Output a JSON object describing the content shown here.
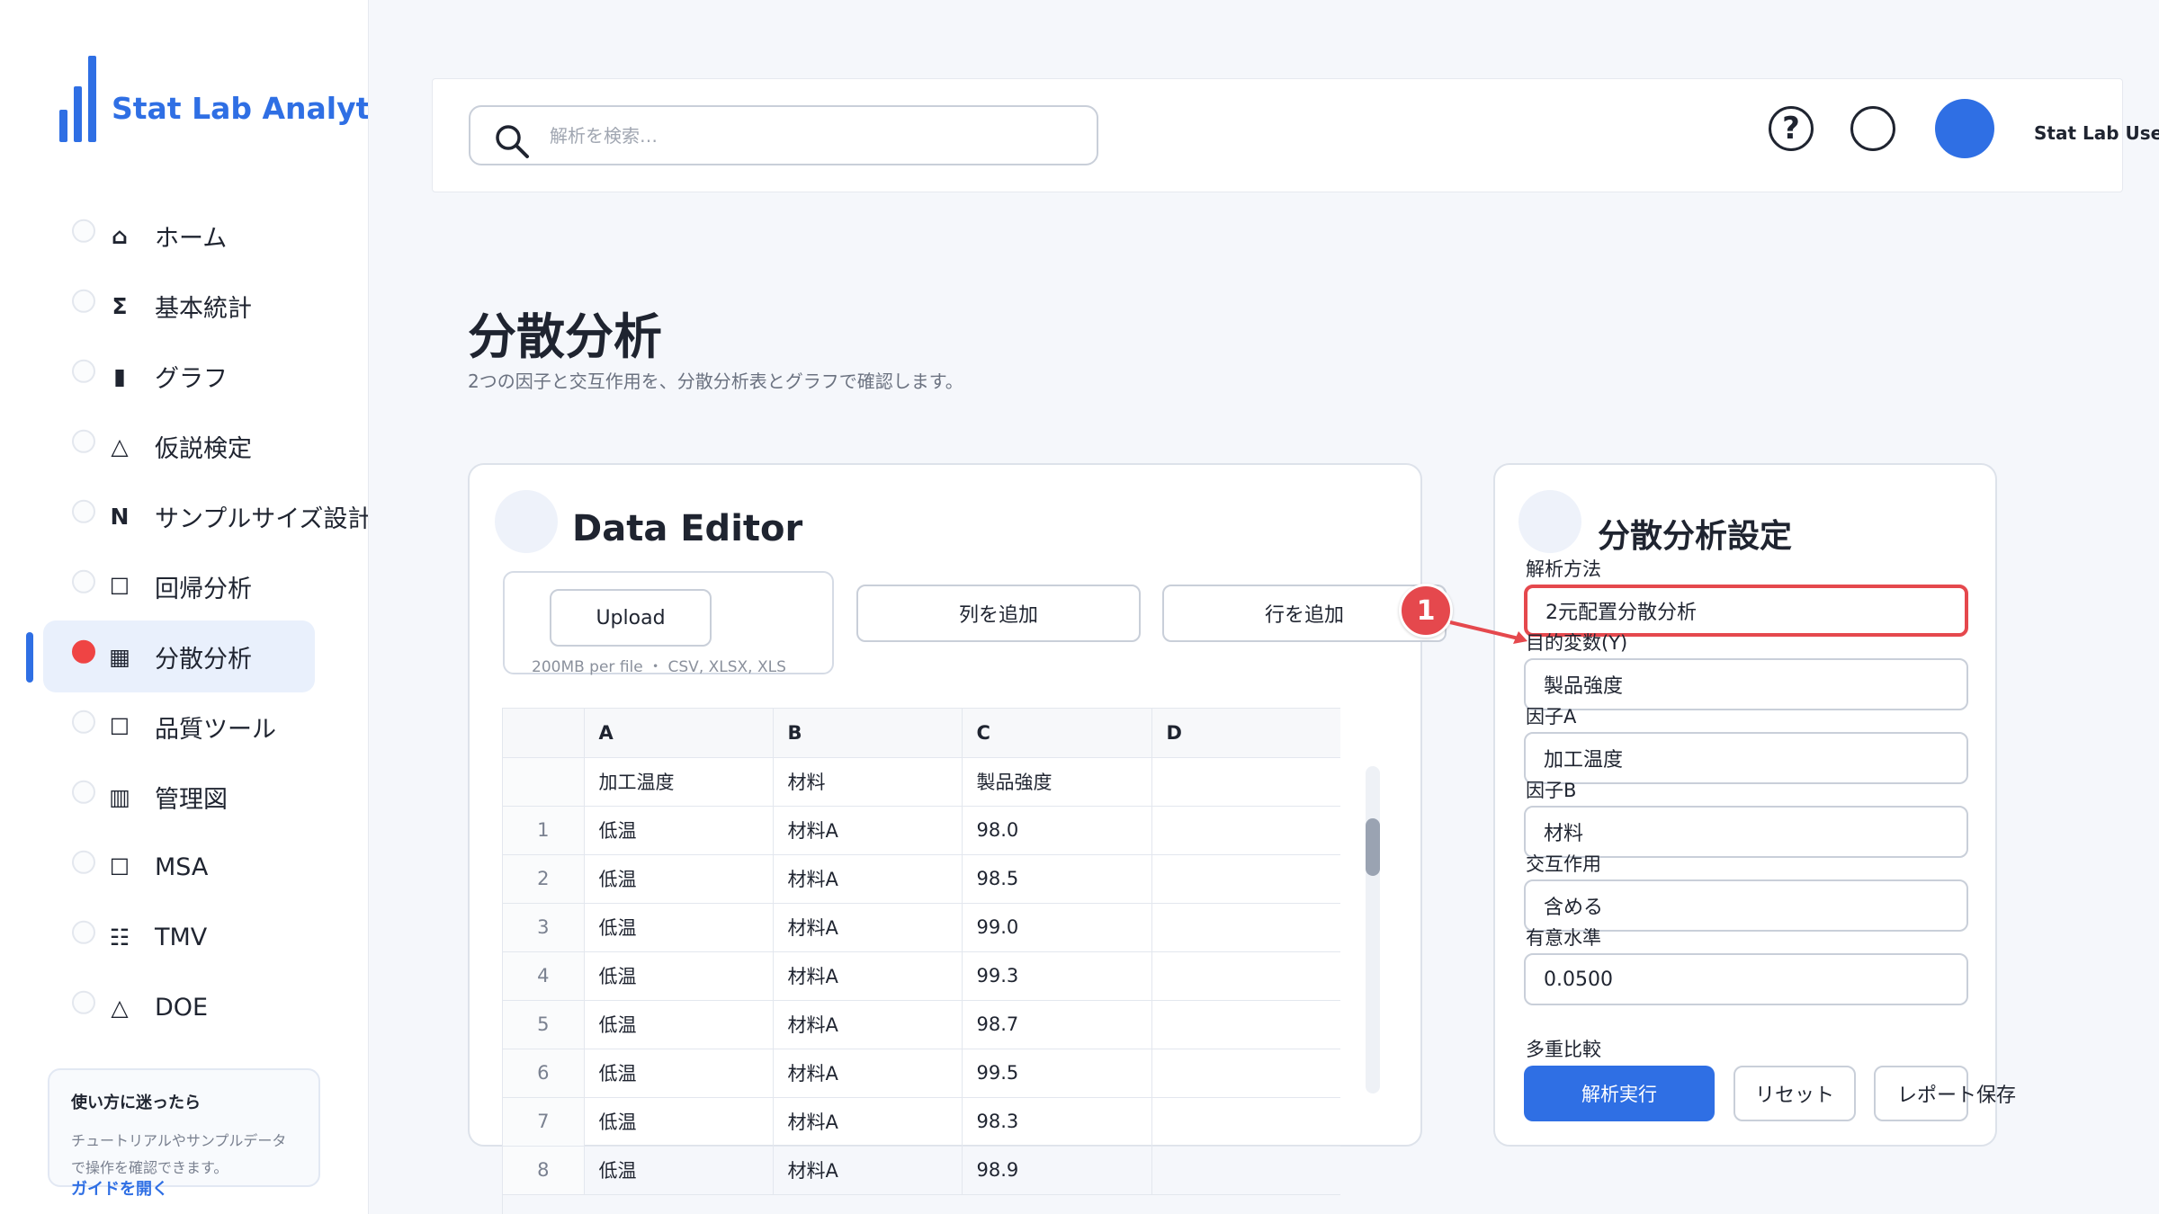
{
  "app": {
    "name": "Stat Lab Analytics"
  },
  "colors": {
    "accent": "#2f6fe4",
    "highlight": "#e5484d"
  },
  "sidebar": {
    "items": [
      {
        "label": "ホーム",
        "icon": "⌂",
        "icon_name": "home-icon"
      },
      {
        "label": "基本統計",
        "icon": "Σ",
        "icon_name": "sigma-icon"
      },
      {
        "label": "グラフ",
        "icon": "▮",
        "icon_name": "bar-chart-icon"
      },
      {
        "label": "仮説検定",
        "icon": "△",
        "icon_name": "triangle-icon"
      },
      {
        "label": "サンプルサイズ設計",
        "icon": "N",
        "icon_name": "n-icon"
      },
      {
        "label": "回帰分析",
        "icon": "☐",
        "icon_name": "square-icon"
      },
      {
        "label": "分散分析",
        "icon": "▦",
        "icon_name": "grid-icon",
        "active": true
      },
      {
        "label": "品質ツール",
        "icon": "☐",
        "icon_name": "square-icon"
      },
      {
        "label": "管理図",
        "icon": "▥",
        "icon_name": "control-chart-icon"
      },
      {
        "label": "MSA",
        "icon": "☐",
        "icon_name": "square-icon"
      },
      {
        "label": "TMV",
        "icon": "☷",
        "icon_name": "list-icon"
      },
      {
        "label": "DOE",
        "icon": "△",
        "icon_name": "triangle-icon"
      }
    ],
    "help": {
      "title": "使い方に迷ったら",
      "text": "チュートリアルやサンプルデータで操作を確認できます。",
      "link": "ガイドを開く"
    }
  },
  "header": {
    "search_placeholder": "解析を検索…",
    "help_icon": "?",
    "user_name": "Stat Lab User"
  },
  "page": {
    "title": "分散分析",
    "subtitle": "2つの因子と交互作用を、分散分析表とグラフで確認します。"
  },
  "data_editor": {
    "title": "Data Editor",
    "upload_label": "Upload",
    "upload_hint": "200MB per file ・ CSV, XLSX, XLS",
    "add_column_label": "列を追加",
    "add_row_label": "行を追加",
    "columns": [
      "A",
      "B",
      "C",
      "D"
    ],
    "header_row": [
      "加工温度",
      "材料",
      "製品強度",
      ""
    ],
    "rows": [
      [
        "1",
        "低温",
        "材料A",
        "98.0",
        ""
      ],
      [
        "2",
        "低温",
        "材料A",
        "98.5",
        ""
      ],
      [
        "3",
        "低温",
        "材料A",
        "99.0",
        ""
      ],
      [
        "4",
        "低温",
        "材料A",
        "99.3",
        ""
      ],
      [
        "5",
        "低温",
        "材料A",
        "98.7",
        ""
      ],
      [
        "6",
        "低温",
        "材料A",
        "99.5",
        ""
      ],
      [
        "7",
        "低温",
        "材料A",
        "98.3",
        ""
      ],
      [
        "8",
        "低温",
        "材料A",
        "98.9",
        ""
      ]
    ]
  },
  "settings": {
    "title": "分散分析設定",
    "fields": [
      {
        "label": "解析方法",
        "value": "2元配置分散分析"
      },
      {
        "label": "目的変数(Y)",
        "value": "製品強度"
      },
      {
        "label": "因子A",
        "value": "加工温度"
      },
      {
        "label": "因子B",
        "value": "材料"
      },
      {
        "label": "交互作用",
        "value": "含める"
      },
      {
        "label": "有意水準",
        "value": "0.0500"
      }
    ],
    "multiple_comparison_label": "多重比較",
    "run_label": "解析実行",
    "reset_label": "リセット",
    "save_label": "レポート保存"
  },
  "annotation": {
    "number": "1"
  }
}
